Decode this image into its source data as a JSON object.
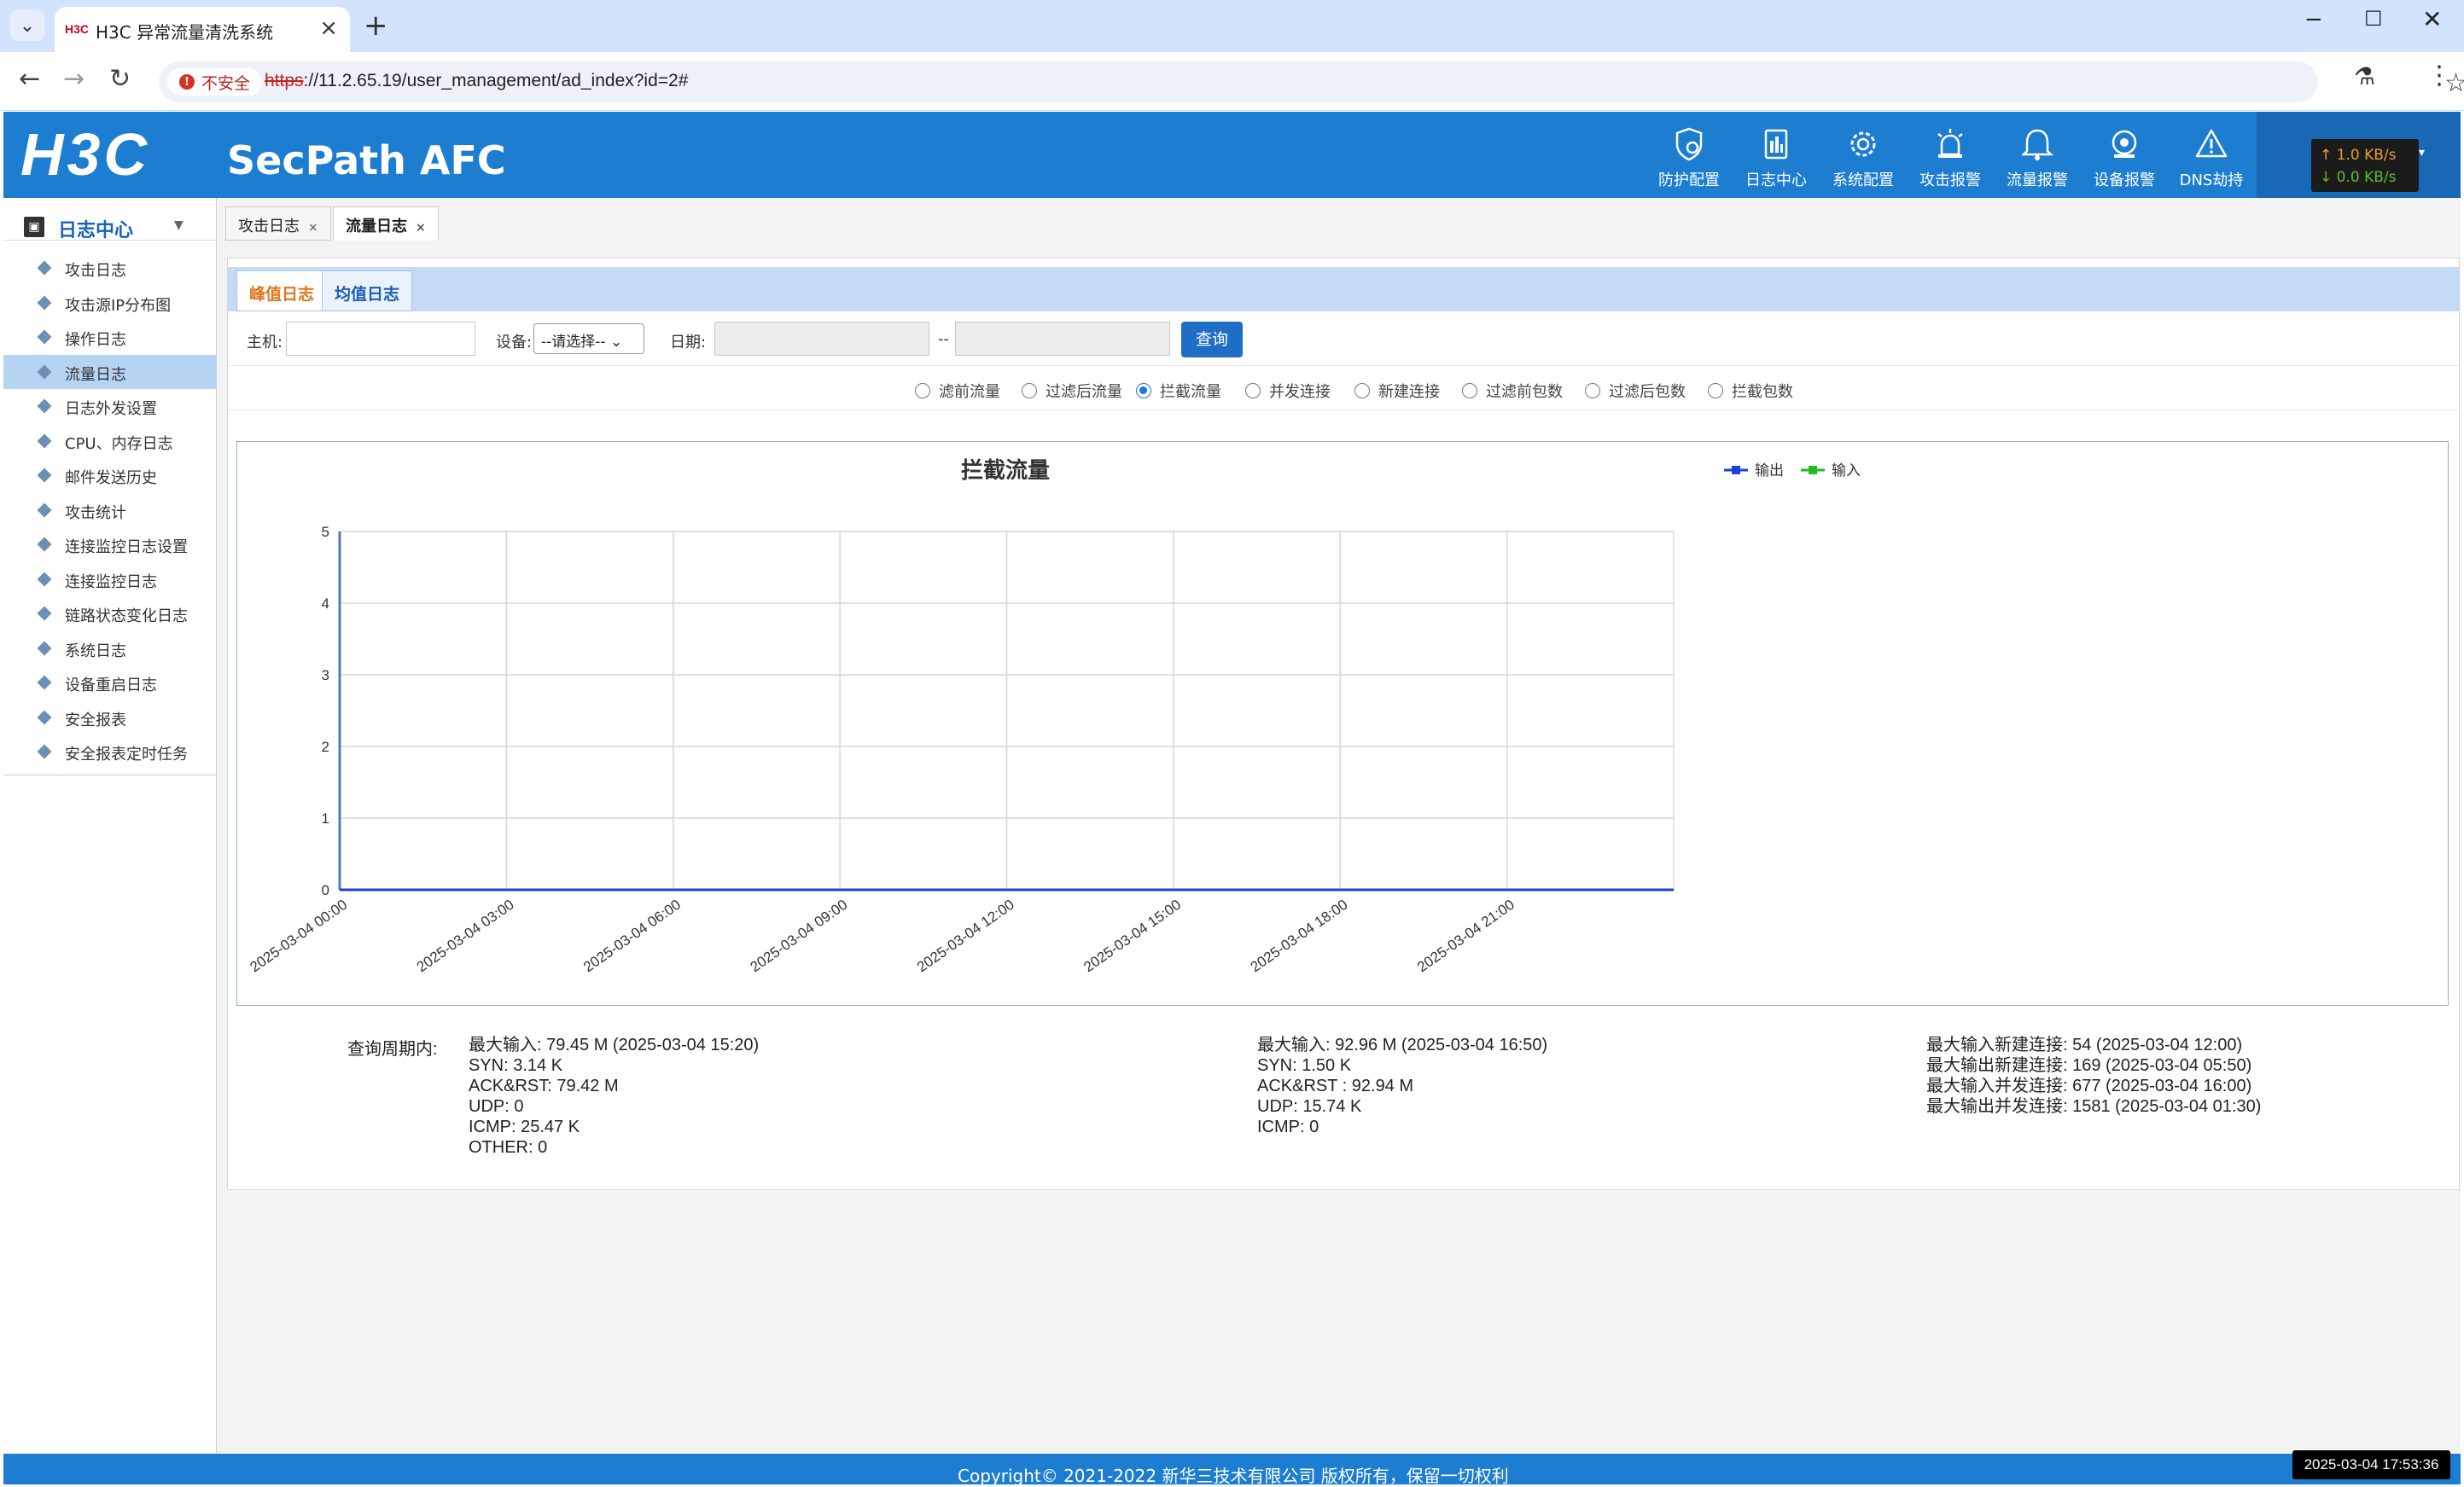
{
  "browser": {
    "tab_title": "H3C 异常流量清洗系统",
    "tab_favicon": "H3C",
    "insecure_label": "不安全",
    "url_scheme": "https",
    "url_rest": "://11.2.65.19/user_management/ad_index?id=2#"
  },
  "header": {
    "logo": "H3C",
    "product": "SecPath AFC",
    "nav": [
      {
        "label": "防护配置",
        "icon": "shield-gear-icon"
      },
      {
        "label": "日志中心",
        "icon": "log-book-icon"
      },
      {
        "label": "系统配置",
        "icon": "gear-icon"
      },
      {
        "label": "攻击报警",
        "icon": "alarm-light-icon"
      },
      {
        "label": "流量报警",
        "icon": "flow-alarm-icon"
      },
      {
        "label": "设备报警",
        "icon": "device-alarm-icon"
      },
      {
        "label": "DNS劫持",
        "icon": "warning-triangle-icon"
      }
    ],
    "traffic_up": "↑ 1.0 KB/s",
    "traffic_down": "↓ 0.0 KB/s"
  },
  "sidebar": {
    "title": "日志中心",
    "items": [
      {
        "label": "攻击日志"
      },
      {
        "label": "攻击源IP分布图"
      },
      {
        "label": "操作日志"
      },
      {
        "label": "流量日志",
        "active": true
      },
      {
        "label": "日志外发设置"
      },
      {
        "label": "CPU、内存日志"
      },
      {
        "label": "邮件发送历史"
      },
      {
        "label": "攻击统计"
      },
      {
        "label": "连接监控日志设置"
      },
      {
        "label": "连接监控日志"
      },
      {
        "label": "链路状态变化日志"
      },
      {
        "label": "系统日志"
      },
      {
        "label": "设备重启日志"
      },
      {
        "label": "安全报表"
      },
      {
        "label": "安全报表定时任务"
      }
    ]
  },
  "page_tabs": [
    {
      "label": "攻击日志",
      "close": "×"
    },
    {
      "label": "流量日志",
      "close": "×"
    }
  ],
  "subtabs": {
    "peak": "峰值日志",
    "avg": "均值日志"
  },
  "filter": {
    "host_label": "主机:",
    "device_label": "设备:",
    "device_value": "--请选择--",
    "date_label": "日期:",
    "date_sep": "--",
    "query_button": "查询"
  },
  "radios": [
    {
      "label": "滤前流量",
      "checked": false
    },
    {
      "label": "过滤后流量",
      "checked": false
    },
    {
      "label": "拦截流量",
      "checked": true
    },
    {
      "label": "并发连接",
      "checked": false
    },
    {
      "label": "新建连接",
      "checked": false
    },
    {
      "label": "过滤前包数",
      "checked": false
    },
    {
      "label": "过滤后包数",
      "checked": false
    },
    {
      "label": "拦截包数",
      "checked": false
    }
  ],
  "colors": {
    "header_blue": "#1c7dd1",
    "series_output": "#1f3fd6",
    "series_input": "#22bb22"
  },
  "chart_data": {
    "type": "line",
    "title": "拦截流量",
    "x": [
      "2025-03-04 00:00",
      "2025-03-04 03:00",
      "2025-03-04 06:00",
      "2025-03-04 09:00",
      "2025-03-04 12:00",
      "2025-03-04 15:00",
      "2025-03-04 18:00",
      "2025-03-04 21:00"
    ],
    "ylim": [
      0,
      5
    ],
    "yticks": [
      0,
      1,
      2,
      3,
      4,
      5
    ],
    "grid": true,
    "legend": "top-right",
    "series": [
      {
        "name": "输出",
        "values": [
          0,
          0,
          0,
          0,
          0,
          0,
          0,
          0,
          0
        ]
      },
      {
        "name": "输入",
        "values": [
          0,
          0,
          0,
          0,
          0,
          0,
          0,
          0,
          0
        ]
      }
    ]
  },
  "stats": {
    "label": "查询周期内:",
    "col1": [
      "最大输入: 79.45 M (2025-03-04 15:20)",
      "SYN: 3.14 K",
      "ACK&RST: 79.42 M",
      "UDP: 0",
      "ICMP: 25.47 K",
      "OTHER: 0"
    ],
    "col2": [
      "最大输入: 92.96 M (2025-03-04 16:50)",
      "SYN: 1.50 K",
      "ACK&RST : 92.94 M",
      "UDP: 15.74 K",
      "ICMP: 0"
    ],
    "col3": [
      "最大输入新建连接: 54 (2025-03-04 12:00)",
      "最大输出新建连接: 169 (2025-03-04 05:50)",
      "最大输入并发连接: 677 (2025-03-04 16:00)",
      "最大输出并发连接: 1581 (2025-03-04 01:30)"
    ]
  },
  "footer": "Copyright© 2021-2022 新华三技术有限公司 版权所有，保留一切权利",
  "clock": "2025-03-04 17:53:36"
}
